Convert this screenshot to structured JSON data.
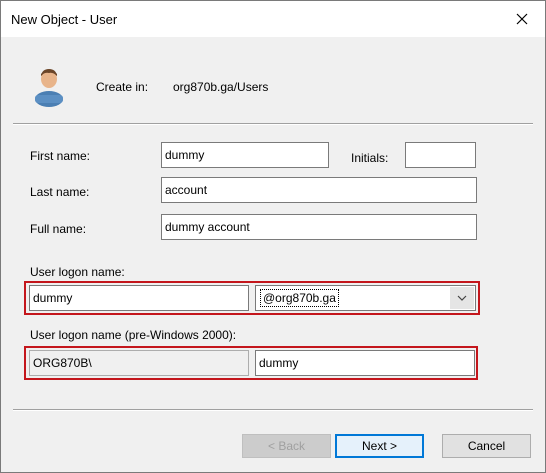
{
  "window": {
    "title": "New Object - User"
  },
  "header": {
    "create_in_label": "Create in:",
    "create_in_value": "org870b.ga/Users"
  },
  "form": {
    "first_name": {
      "label": "First name:",
      "value": "dummy"
    },
    "initials": {
      "label": "Initials:",
      "value": ""
    },
    "last_name": {
      "label": "Last name:",
      "value": "account"
    },
    "full_name": {
      "label": "Full name:",
      "value": "dummy account"
    },
    "logon_name": {
      "label": "User logon name:",
      "value": "dummy",
      "domain_selected": "@org870b.ga"
    },
    "pre2000": {
      "label": "User logon name (pre-Windows 2000):",
      "domain_prefix": "ORG870B\\",
      "value": "dummy"
    }
  },
  "buttons": {
    "back": "< Back",
    "next": "Next >",
    "cancel": "Cancel"
  },
  "colors": {
    "highlight": "#c4161c",
    "focus_button_border": "#0078d7"
  },
  "icons": {
    "close": "close-icon",
    "user": "user-icon",
    "dropdown": "chevron-down-icon"
  }
}
